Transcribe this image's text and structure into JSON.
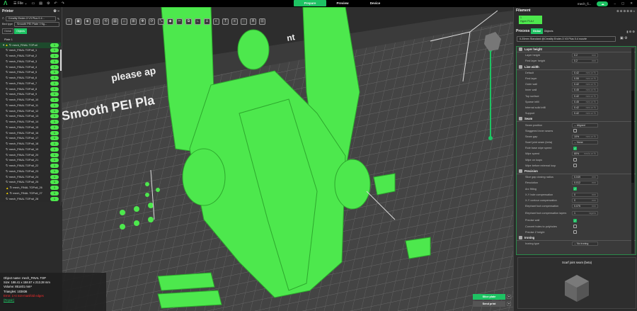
{
  "topbar": {
    "menu_label": "File",
    "tabs": [
      "Prepare",
      "Preview",
      "Device"
    ],
    "active_tab": "Prepare",
    "user": "mech_fi..."
  },
  "printer": {
    "title": "Printer",
    "printer_name": "Creality Ender-3 V3 Plus 0.4...",
    "bed_type_label": "Bed type",
    "bed_type": "Smooth PEI Plate / Hig...",
    "view_tabs": [
      "Global",
      "Objects"
    ],
    "plate": "Plate 1",
    "objects": [
      {
        "name": "mech_FINAL TOP.stl",
        "count": "1",
        "warn": true
      },
      {
        "name": "mech_FINAL TOP.stl_1",
        "count": "1"
      },
      {
        "name": "mech_FINAL TOP.stl_2",
        "count": "1"
      },
      {
        "name": "mech_FINAL TOP.stl_3",
        "count": "1"
      },
      {
        "name": "mech_FINAL TOP.stl_4",
        "count": "1"
      },
      {
        "name": "mech_FINAL TOP.stl_5",
        "count": "1"
      },
      {
        "name": "mech_FINAL TOP.stl_6",
        "count": "1"
      },
      {
        "name": "mech_FINAL TOP.stl_7",
        "count": "1"
      },
      {
        "name": "mech_FINAL TOP.stl_8",
        "count": "1"
      },
      {
        "name": "mech_FINAL TOP.stl_9",
        "count": "1"
      },
      {
        "name": "mech_FINAL TOP.stl_10",
        "count": "1"
      },
      {
        "name": "mech_FINAL TOP.stl_11",
        "count": "1"
      },
      {
        "name": "mech_FINAL TOP.stl_12",
        "count": "1"
      },
      {
        "name": "mech_FINAL TOP.stl_13",
        "count": "1"
      },
      {
        "name": "mech_FINAL TOP.stl_14",
        "count": "1"
      },
      {
        "name": "mech_FINAL TOP.stl_15",
        "count": "1"
      },
      {
        "name": "mech_FINAL TOP.stl_16",
        "count": "1"
      },
      {
        "name": "mech_FINAL TOP.stl_17",
        "count": "1"
      },
      {
        "name": "mech_FINAL TOP.stl_18",
        "count": "1"
      },
      {
        "name": "mech_FINAL TOP.stl_19",
        "count": "1"
      },
      {
        "name": "mech_FINAL TOP.stl_20",
        "count": "1"
      },
      {
        "name": "mech_FINAL TOP.stl_21",
        "count": "1"
      },
      {
        "name": "mech_FINAL TOP.stl_22",
        "count": "1"
      },
      {
        "name": "mech_FINAL TOP.stl_23",
        "count": "1"
      },
      {
        "name": "mech_FINAL TOP.stl_24",
        "count": "1"
      },
      {
        "name": "mech_FINAL TOP.stl_25",
        "count": "1"
      },
      {
        "name": "mech_FINAL TOP.stl_26",
        "count": "1",
        "warn": true
      },
      {
        "name": "mech_FINAL TOP.stl_27",
        "count": "1",
        "warn": true
      },
      {
        "name": "mech_FINAL TOP.stl_28",
        "count": "1"
      }
    ]
  },
  "info": {
    "object_name": "Object name: mech_FINAL TOP",
    "size": "Size: 188.41 x 158.57 x 213.28 mm",
    "volume": "Volume: 851401 mm³",
    "triangles": "Triangles: 103836",
    "error": "Error: 1×4 non-manifold edges",
    "repair": "(Repair)"
  },
  "plate_text": {
    "line1": "please ap",
    "line2": "Smooth PEI Pla",
    "line3": "nt"
  },
  "filament": {
    "title": "Filament",
    "slot": "1",
    "material": "Hyper PLA-f"
  },
  "process": {
    "title": "Process",
    "tabs": [
      "Global",
      "Objects"
    ],
    "preset": "0.20mm Standard @Creality Ender-3 V3 Plus 0.4 nozzle"
  },
  "settings": [
    {
      "title": "Layer height",
      "rows": [
        {
          "label": "Layer height",
          "value": "0.2",
          "unit": "mm"
        },
        {
          "label": "First layer height",
          "value": "0.2",
          "unit": "mm"
        }
      ]
    },
    {
      "title": "Line width",
      "rows": [
        {
          "label": "Default",
          "value": "0.42",
          "unit": "mm or %"
        },
        {
          "label": "First layer",
          "value": "0.55",
          "unit": "mm or %"
        },
        {
          "label": "Outer wall",
          "value": "0.42",
          "unit": "mm or %"
        },
        {
          "label": "Inner wall",
          "value": "0.45",
          "unit": "mm or %"
        },
        {
          "label": "Top surface",
          "value": "0.42",
          "unit": "mm or %"
        },
        {
          "label": "Sparse infill",
          "value": "0.45",
          "unit": "mm or %"
        },
        {
          "label": "Internal solid infill",
          "value": "0.42",
          "unit": "mm or %"
        },
        {
          "label": "Support",
          "value": "0.42",
          "unit": "mm or %"
        }
      ]
    },
    {
      "title": "Seam",
      "rows": [
        {
          "label": "Seam position",
          "value": "Aligned",
          "type": "select"
        },
        {
          "label": "Staggered inner seams",
          "type": "check",
          "checked": false
        },
        {
          "label": "Seam gap",
          "value": "10%",
          "unit": "mm or %"
        },
        {
          "label": "Scarf joint seam (beta)",
          "value": "None",
          "type": "select"
        },
        {
          "label": "Role base wipe speed",
          "type": "check",
          "checked": true
        },
        {
          "label": "Wipe speed",
          "value": "80%",
          "unit": "mm/s or %"
        },
        {
          "label": "Wipe on loops",
          "type": "check",
          "checked": false
        },
        {
          "label": "Wipe before external loop",
          "type": "check",
          "checked": false
        }
      ]
    },
    {
      "title": "Precision",
      "rows": [
        {
          "label": "Slice gap closing radius",
          "value": "0.049",
          "unit": "mm"
        },
        {
          "label": "Resolution",
          "value": "0.012",
          "unit": "mm"
        },
        {
          "label": "Arc fitting",
          "type": "check",
          "checked": true
        },
        {
          "label": "X-Y hole compensation",
          "value": "0",
          "unit": "mm"
        },
        {
          "label": "X-Y contour compensation",
          "value": "0",
          "unit": "mm"
        },
        {
          "label": "Elephant foot compensation",
          "value": "0.075",
          "unit": "mm"
        },
        {
          "label": "Elephant foot compensation layers",
          "value": "1",
          "unit": "layers",
          "tall": true
        },
        {
          "label": "Precise wall",
          "type": "check",
          "checked": true
        },
        {
          "label": "Convert holes to polyholes",
          "type": "check",
          "checked": false
        },
        {
          "label": "Precise Z height",
          "type": "check",
          "checked": false
        }
      ]
    },
    {
      "title": "Ironing",
      "rows": [
        {
          "label": "Ironing type",
          "value": "No ironing",
          "type": "select"
        }
      ]
    }
  ],
  "preview": {
    "title": "Scarf joint seam (beta)"
  },
  "actions": {
    "slice": "Slice plate",
    "send": "Send print"
  },
  "colors": {
    "accent": "#1ec363",
    "model": "#4de84d"
  }
}
